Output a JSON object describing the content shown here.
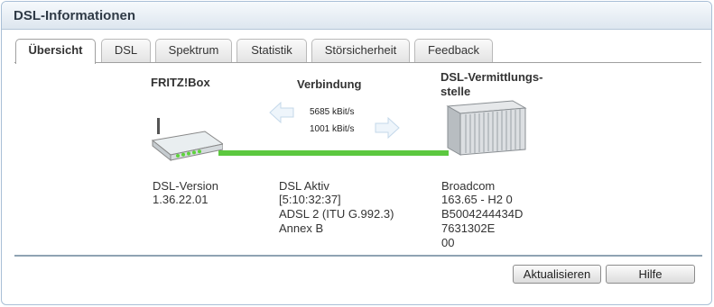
{
  "window": {
    "title": "DSL-Informationen"
  },
  "tabs": [
    {
      "label": "Übersicht",
      "active": true
    },
    {
      "label": "DSL"
    },
    {
      "label": "Spektrum"
    },
    {
      "label": "Statistik"
    },
    {
      "label": "Störsicherheit"
    },
    {
      "label": "Feedback"
    }
  ],
  "overview": {
    "fritzbox": {
      "header": "FRITZ!Box",
      "lines": [
        "DSL-Version",
        "1.36.22.01"
      ]
    },
    "connection": {
      "header": "Verbindung",
      "downstream": "5685 kBit/s",
      "upstream": "1001 kBit/s",
      "lines": [
        "DSL Aktiv",
        "[5:10:32:37]",
        "ADSL 2 (ITU G.992.3)",
        "Annex B"
      ]
    },
    "exchange": {
      "header_line1": "DSL-Vermittlungs-",
      "header_line2": "stelle",
      "lines": [
        "Broadcom",
        "163.65 - H2 0",
        "B5004244434D",
        "7631302E",
        "00"
      ]
    }
  },
  "buttons": {
    "refresh": "Aktualisieren",
    "help": "Hilfe"
  },
  "colors": {
    "link_line": "#5cc83f",
    "arrow": "#d9e9f7",
    "title_bg": "#dde6ef"
  }
}
